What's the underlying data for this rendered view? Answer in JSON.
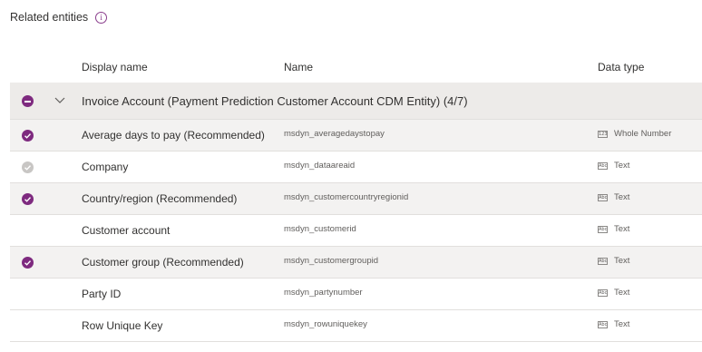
{
  "header": {
    "title": "Related entities"
  },
  "columns": {
    "display_name": "Display name",
    "name": "Name",
    "data_type": "Data type"
  },
  "group": {
    "label": "Invoice Account (Payment Prediction Customer Account CDM Entity) (4/7)"
  },
  "rows": [
    {
      "display": "Average days to pay (Recommended)",
      "name": "msdyn_averagedaystopay",
      "type": "Whole Number",
      "type_icon": "123",
      "state": "checked"
    },
    {
      "display": "Company",
      "name": "msdyn_dataareaid",
      "type": "Text",
      "type_icon": "Abc",
      "state": "disabled"
    },
    {
      "display": "Country/region (Recommended)",
      "name": "msdyn_customercountryregionid",
      "type": "Text",
      "type_icon": "Abc",
      "state": "checked"
    },
    {
      "display": "Customer account",
      "name": "msdyn_customerid",
      "type": "Text",
      "type_icon": "Abc",
      "state": "none"
    },
    {
      "display": "Customer group (Recommended)",
      "name": "msdyn_customergroupid",
      "type": "Text",
      "type_icon": "Abc",
      "state": "checked"
    },
    {
      "display": "Party ID",
      "name": "msdyn_partynumber",
      "type": "Text",
      "type_icon": "Abc",
      "state": "none"
    },
    {
      "display": "Row Unique Key",
      "name": "msdyn_rowuniquekey",
      "type": "Text",
      "type_icon": "Abc",
      "state": "none"
    }
  ],
  "colors": {
    "accent": "#7e2a7f",
    "disabled": "#c8c6c4",
    "selected_row": "#f3f2f1",
    "group_row": "#edebe9"
  }
}
